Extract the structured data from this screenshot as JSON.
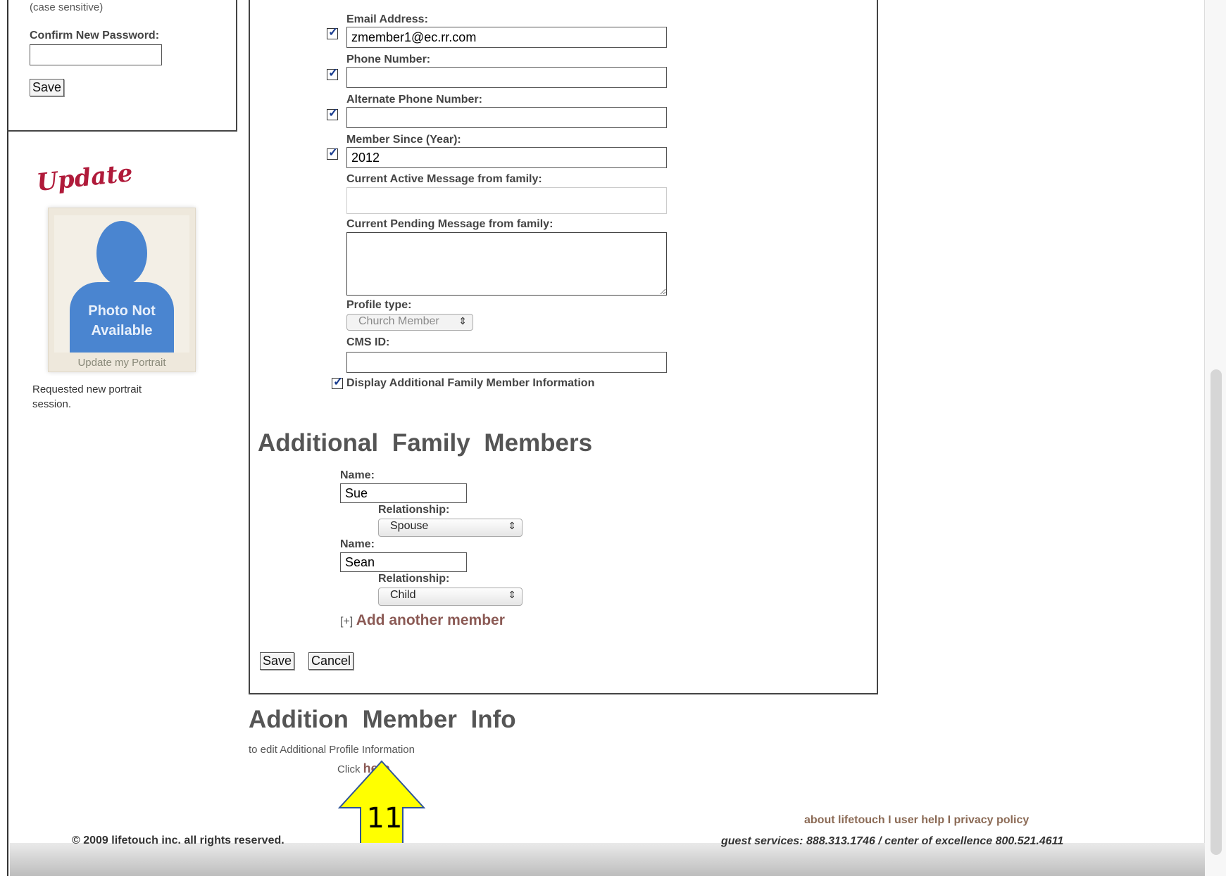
{
  "password_panel": {
    "case_note": "(case sensitive)",
    "confirm_label": "Confirm New Password:",
    "confirm_value": "",
    "save_label": "Save"
  },
  "portrait": {
    "update_title": "Update",
    "photo_line1": "Photo Not",
    "photo_line2": "Available",
    "update_link": "Update my Portrait",
    "requested_line1": "Requested new portrait",
    "requested_line2": "session."
  },
  "form": {
    "email_label": "Email Address:",
    "email_value": "zmember1@ec.rr.com",
    "phone_label": "Phone Number:",
    "phone_value": "",
    "alt_phone_label": "Alternate Phone Number:",
    "alt_phone_value": "",
    "member_since_label": "Member Since (Year):",
    "member_since_value": "2012",
    "active_msg_label": "Current Active Message from family:",
    "pending_msg_label": "Current Pending Message from family:",
    "profile_type_label": "Profile type:",
    "profile_type_value": "Church Member",
    "cms_id_label": "CMS ID:",
    "cms_id_value": "",
    "display_family_label": "Display Additional Family Member Information"
  },
  "family": {
    "heading": "Additional Family Members",
    "members": [
      {
        "name_label": "Name:",
        "name": "Sue",
        "relationship_label": "Relationship:",
        "relationship": "Spouse"
      },
      {
        "name_label": "Name:",
        "name": "Sean",
        "relationship_label": "Relationship:",
        "relationship": "Child"
      }
    ],
    "add_prefix": "[+]",
    "add_label": "Add another member",
    "save_label": "Save",
    "cancel_label": "Cancel"
  },
  "addition_info": {
    "heading": "Addition Member Info",
    "text": "to edit Additional Profile Information",
    "click_text": "Click",
    "here_link": "here"
  },
  "annotation": {
    "number": "11",
    "color": "#ffff00"
  },
  "footer": {
    "copyright": "© 2009 lifetouch inc. all rights reserved.",
    "about": "about lifetouch",
    "sep": "I",
    "user_help": "user help",
    "privacy": "privacy policy",
    "services": "guest services: 888.313.1746 / center of excellence 800.521.4611"
  }
}
